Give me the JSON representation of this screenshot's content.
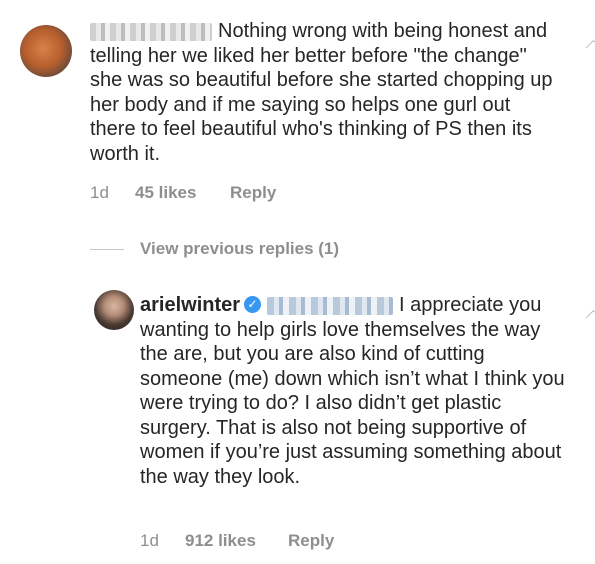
{
  "comment1": {
    "text": "Nothing wrong with being honest and telling her we liked her better before \"the change\" she was so beautiful before she started chopping up her body and if me saying so helps one gurl out there to feel beautiful who's thinking of PS then its worth it.",
    "time": "1d",
    "likes": "45 likes",
    "reply": "Reply"
  },
  "view_replies": "View previous replies (1)",
  "comment2": {
    "username": "arielwinter",
    "text": "I appreciate you wanting to help girls love themselves the way the are, but you are also kind of cutting someone (me) down which isn’t what I think you were trying to do? I also didn’t get plastic surgery. That is also not being supportive of women if you’re just assuming something about the way they look.",
    "time": "1d",
    "likes": "912 likes",
    "reply": "Reply"
  },
  "icons": {
    "verified": "verified-badge-icon",
    "like": "heart-icon"
  },
  "colors": {
    "text": "#262626",
    "secondary": "#8e8e8e",
    "verified": "#3897f0"
  }
}
